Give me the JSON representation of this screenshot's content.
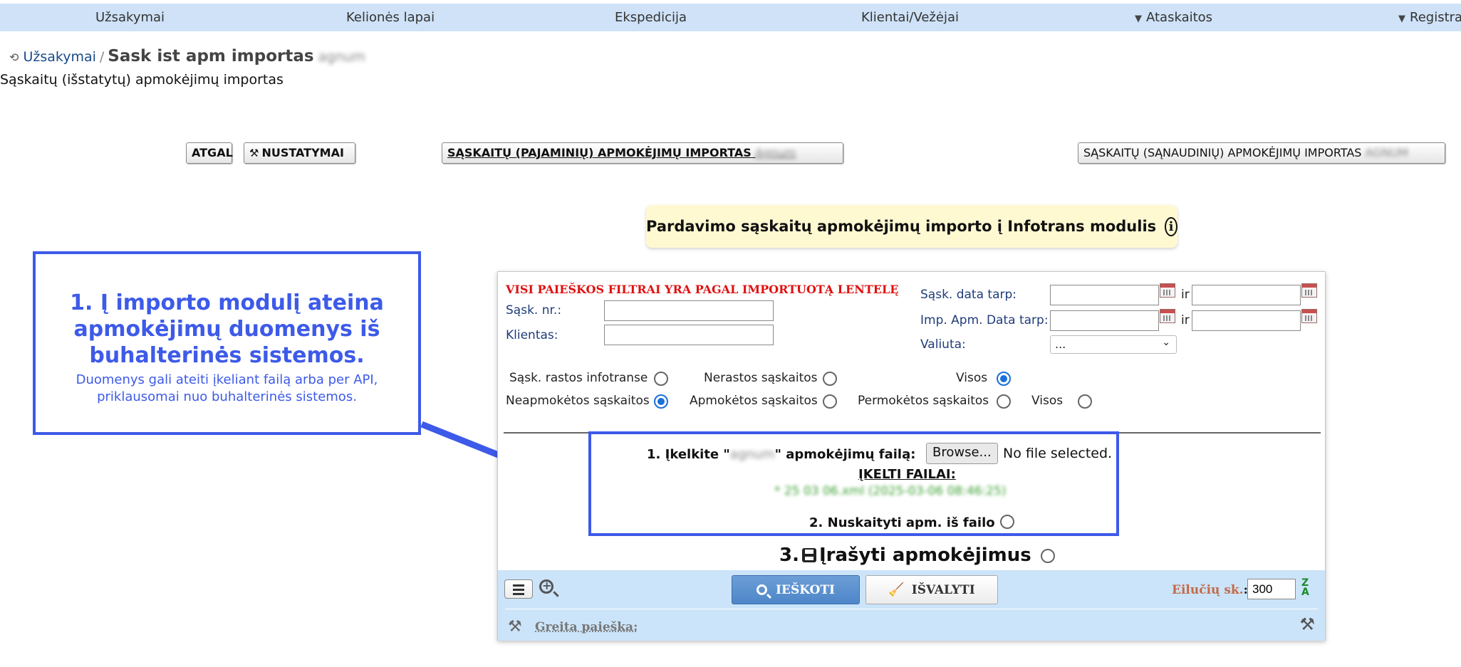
{
  "nav": {
    "items": [
      "Užsakymai",
      "Kelionės lapai",
      "Ekspedicija",
      "Klientai/Vežėjai",
      "Ataskaitos",
      "Registrai"
    ]
  },
  "breadcrumb": {
    "link": "Užsakymai",
    "separator": "/",
    "title": "Sask ist apm importas",
    "title_suffix_blurred": "agnum"
  },
  "subtitle": "Sąskaitų (išstatytų) apmokėjimų importas",
  "buttons": {
    "back": "ATGAL",
    "settings": "NUSTATYMAI",
    "income_import": "SĄSKAITŲ (PAJAMINIŲ) APMOKĖJIMŲ IMPORTAS",
    "income_suffix_blurred": "Agnum",
    "expense_import": "SĄSKAITŲ (SĄNAUDINIŲ) APMOKĖJIMŲ IMPORTAS",
    "expense_suffix_blurred": "AGNUM"
  },
  "info_banner": {
    "text": "Pardavimo sąskaitų apmokėjimų importo į Infotrans modulis",
    "icon": "info-icon"
  },
  "callout": {
    "heading": "1. Į importo modulį ateina apmokėjimų duomenys iš buhalterinės sistemos.",
    "description": "Duomenys gali ateiti įkeliant failą arba per API, priklausomai nuo buhalterinės sistemos."
  },
  "filters": {
    "notice": "VISI PAIEŠKOS FILTRAI YRA PAGAL IMPORTUOTĄ LENTELĘ",
    "invoice_no_label": "Sąsk. nr.:",
    "client_label": "Klientas:",
    "invoice_date_label": "Sąsk. data tarp:",
    "imp_date_label": "Imp. Apm. Data tarp:",
    "and_label": "ir",
    "currency_label": "Valiuta:",
    "currency_value": "..."
  },
  "radios": {
    "row1": [
      {
        "label": "Sąsk. rastos infotranse",
        "checked": false
      },
      {
        "label": "Nerastos sąskaitos",
        "checked": false
      },
      {
        "label": "Visos",
        "checked": true
      }
    ],
    "row2": [
      {
        "label": "Neapmokėtos sąskaitos",
        "checked": true
      },
      {
        "label": "Apmokėtos sąskaitos",
        "checked": false
      },
      {
        "label": "Permokėtos sąskaitos",
        "checked": false
      },
      {
        "label": "Visos",
        "checked": false
      }
    ]
  },
  "upload": {
    "step1_prefix": "1. Įkelkite \"",
    "step1_blurred": "agnum",
    "step1_suffix": "\" apmokėjimų failą:",
    "browse_label": "Browse...",
    "no_file": "No file selected.",
    "uploaded_title": "ĮKELTI FAILAI:",
    "uploaded_file_blurred": "* 25 03 06.xml (2025-03-06 08:46:25)",
    "step2": "2. Nuskaityti apm. iš failo"
  },
  "step3": {
    "prefix": "3.",
    "label": "Įrašyti apmokėjimus"
  },
  "action_bar": {
    "search_label": "IEŠKOTI",
    "clear_label": "IŠVALYTI",
    "rows_label": "Eilučių sk.",
    "rows_colon": ":",
    "rows_value": "300",
    "sort_top": "Z",
    "sort_bottom": "A",
    "quick_search_label": "Greita paieška:"
  },
  "colors": {
    "nav_bg": "#cfe2f7",
    "callout_blue": "#3d5ae8",
    "banner_bg": "#fff9d2",
    "notice_red": "#e01010",
    "bar_bg": "#cbe4f9",
    "search_btn": "#4d86c9",
    "radio_checked": "#1b6fd8"
  }
}
